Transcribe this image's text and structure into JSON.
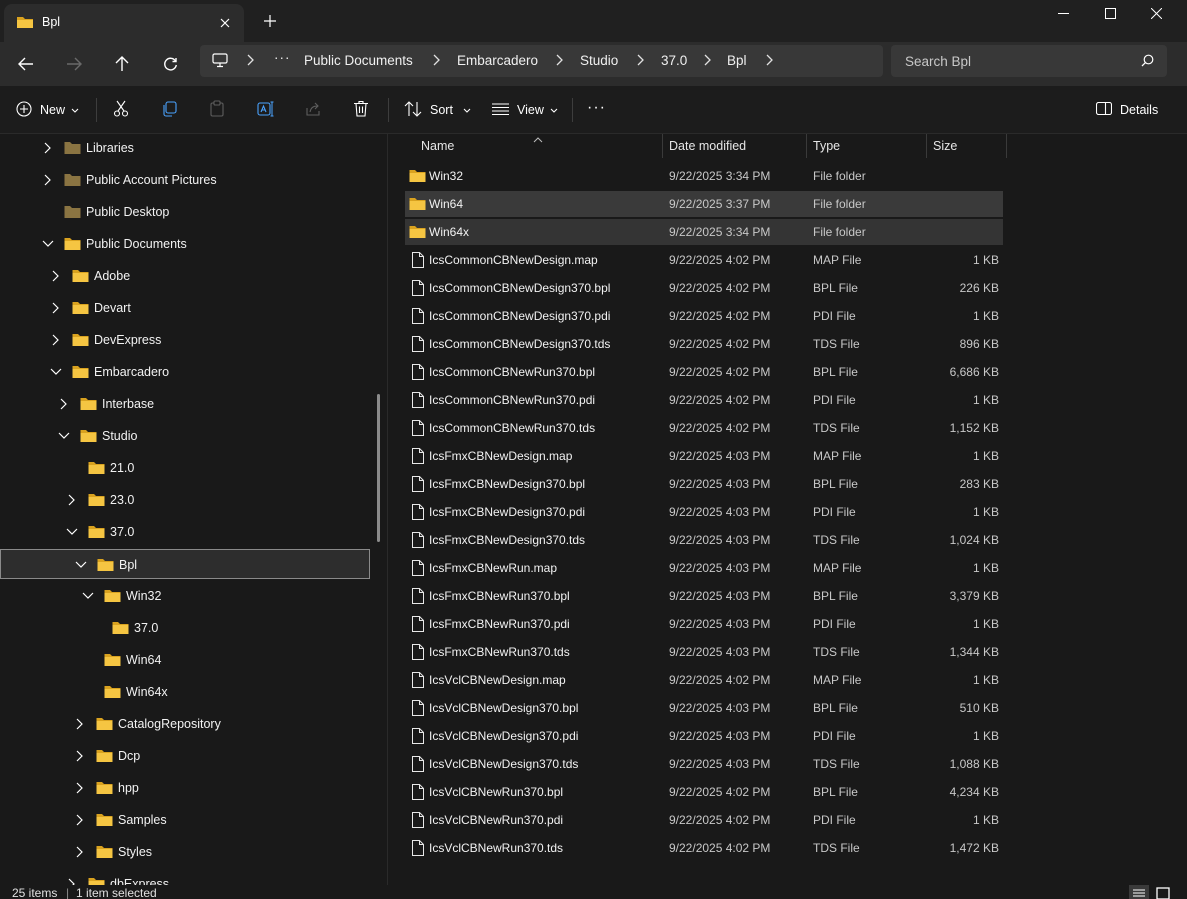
{
  "window": {
    "tab_title": "Bpl",
    "close_tab_symbol": "✕",
    "new_tab_symbol": "+",
    "minimize_symbol": "—",
    "maximize_symbol": "☐",
    "close_symbol": "✕"
  },
  "address": {
    "ellipsis": "···",
    "crumbs": [
      "Public Documents",
      "Embarcadero",
      "Studio",
      "37.0",
      "Bpl"
    ],
    "search_placeholder": "Search Bpl"
  },
  "commands": {
    "new_label": "New",
    "sort_label": "Sort",
    "view_label": "View",
    "more_label": "···",
    "details_label": "Details"
  },
  "sidebar": {
    "items": [
      {
        "label": "Libraries",
        "expanded": false,
        "has_children": true
      },
      {
        "label": "Public Account Pictures",
        "expanded": false,
        "has_children": true
      },
      {
        "label": "Public Desktop",
        "expanded": false,
        "has_children": false
      },
      {
        "label": "Public Documents",
        "expanded": true,
        "has_children": true
      },
      {
        "label": "Adobe",
        "expanded": false,
        "has_children": true
      },
      {
        "label": "Devart",
        "expanded": false,
        "has_children": true
      },
      {
        "label": "DevExpress",
        "expanded": false,
        "has_children": true
      },
      {
        "label": "Embarcadero",
        "expanded": true,
        "has_children": true
      },
      {
        "label": "Interbase",
        "expanded": false,
        "has_children": true
      },
      {
        "label": "Studio",
        "expanded": true,
        "has_children": true
      },
      {
        "label": "21.0",
        "expanded": false,
        "has_children": false
      },
      {
        "label": "23.0",
        "expanded": false,
        "has_children": true
      },
      {
        "label": "37.0",
        "expanded": true,
        "has_children": true
      },
      {
        "label": "Bpl",
        "expanded": true,
        "has_children": true,
        "selected": true
      },
      {
        "label": "Win32",
        "expanded": true,
        "has_children": true
      },
      {
        "label": "37.0",
        "expanded": false,
        "has_children": false
      },
      {
        "label": "Win64",
        "expanded": false,
        "has_children": false
      },
      {
        "label": "Win64x",
        "expanded": false,
        "has_children": false
      },
      {
        "label": "CatalogRepository",
        "expanded": false,
        "has_children": true
      },
      {
        "label": "Dcp",
        "expanded": false,
        "has_children": true
      },
      {
        "label": "hpp",
        "expanded": false,
        "has_children": true
      },
      {
        "label": "Samples",
        "expanded": false,
        "has_children": true
      },
      {
        "label": "Styles",
        "expanded": false,
        "has_children": true
      },
      {
        "label": "dbExpress",
        "expanded": false,
        "has_children": true
      }
    ]
  },
  "filelist": {
    "columns": {
      "name": "Name",
      "date": "Date modified",
      "type": "Type",
      "size": "Size"
    },
    "rows": [
      {
        "name": "Win32",
        "date": "9/22/2025 3:34 PM",
        "type": "File folder",
        "size": "",
        "kind": "folder"
      },
      {
        "name": "Win64",
        "date": "9/22/2025 3:37 PM",
        "type": "File folder",
        "size": "",
        "kind": "folder",
        "state": "selected"
      },
      {
        "name": "Win64x",
        "date": "9/22/2025 3:34 PM",
        "type": "File folder",
        "size": "",
        "kind": "folder",
        "state": "hover"
      },
      {
        "name": "IcsCommonCBNewDesign.map",
        "date": "9/22/2025 4:02 PM",
        "type": "MAP File",
        "size": "1 KB",
        "kind": "file"
      },
      {
        "name": "IcsCommonCBNewDesign370.bpl",
        "date": "9/22/2025 4:02 PM",
        "type": "BPL File",
        "size": "226 KB",
        "kind": "file"
      },
      {
        "name": "IcsCommonCBNewDesign370.pdi",
        "date": "9/22/2025 4:02 PM",
        "type": "PDI File",
        "size": "1 KB",
        "kind": "file"
      },
      {
        "name": "IcsCommonCBNewDesign370.tds",
        "date": "9/22/2025 4:02 PM",
        "type": "TDS File",
        "size": "896 KB",
        "kind": "file"
      },
      {
        "name": "IcsCommonCBNewRun370.bpl",
        "date": "9/22/2025 4:02 PM",
        "type": "BPL File",
        "size": "6,686 KB",
        "kind": "file"
      },
      {
        "name": "IcsCommonCBNewRun370.pdi",
        "date": "9/22/2025 4:02 PM",
        "type": "PDI File",
        "size": "1 KB",
        "kind": "file"
      },
      {
        "name": "IcsCommonCBNewRun370.tds",
        "date": "9/22/2025 4:02 PM",
        "type": "TDS File",
        "size": "1,152 KB",
        "kind": "file"
      },
      {
        "name": "IcsFmxCBNewDesign.map",
        "date": "9/22/2025 4:03 PM",
        "type": "MAP File",
        "size": "1 KB",
        "kind": "file"
      },
      {
        "name": "IcsFmxCBNewDesign370.bpl",
        "date": "9/22/2025 4:03 PM",
        "type": "BPL File",
        "size": "283 KB",
        "kind": "file"
      },
      {
        "name": "IcsFmxCBNewDesign370.pdi",
        "date": "9/22/2025 4:03 PM",
        "type": "PDI File",
        "size": "1 KB",
        "kind": "file"
      },
      {
        "name": "IcsFmxCBNewDesign370.tds",
        "date": "9/22/2025 4:03 PM",
        "type": "TDS File",
        "size": "1,024 KB",
        "kind": "file"
      },
      {
        "name": "IcsFmxCBNewRun.map",
        "date": "9/22/2025 4:03 PM",
        "type": "MAP File",
        "size": "1 KB",
        "kind": "file"
      },
      {
        "name": "IcsFmxCBNewRun370.bpl",
        "date": "9/22/2025 4:03 PM",
        "type": "BPL File",
        "size": "3,379 KB",
        "kind": "file"
      },
      {
        "name": "IcsFmxCBNewRun370.pdi",
        "date": "9/22/2025 4:03 PM",
        "type": "PDI File",
        "size": "1 KB",
        "kind": "file"
      },
      {
        "name": "IcsFmxCBNewRun370.tds",
        "date": "9/22/2025 4:03 PM",
        "type": "TDS File",
        "size": "1,344 KB",
        "kind": "file"
      },
      {
        "name": "IcsVclCBNewDesign.map",
        "date": "9/22/2025 4:02 PM",
        "type": "MAP File",
        "size": "1 KB",
        "kind": "file"
      },
      {
        "name": "IcsVclCBNewDesign370.bpl",
        "date": "9/22/2025 4:03 PM",
        "type": "BPL File",
        "size": "510 KB",
        "kind": "file"
      },
      {
        "name": "IcsVclCBNewDesign370.pdi",
        "date": "9/22/2025 4:03 PM",
        "type": "PDI File",
        "size": "1 KB",
        "kind": "file"
      },
      {
        "name": "IcsVclCBNewDesign370.tds",
        "date": "9/22/2025 4:03 PM",
        "type": "TDS File",
        "size": "1,088 KB",
        "kind": "file"
      },
      {
        "name": "IcsVclCBNewRun370.bpl",
        "date": "9/22/2025 4:02 PM",
        "type": "BPL File",
        "size": "4,234 KB",
        "kind": "file"
      },
      {
        "name": "IcsVclCBNewRun370.pdi",
        "date": "9/22/2025 4:02 PM",
        "type": "PDI File",
        "size": "1 KB",
        "kind": "file"
      },
      {
        "name": "IcsVclCBNewRun370.tds",
        "date": "9/22/2025 4:02 PM",
        "type": "TDS File",
        "size": "1,472 KB",
        "kind": "file"
      }
    ]
  },
  "status": {
    "item_count": "25 items",
    "divider": "|",
    "selection": "1 item selected"
  },
  "colors": {
    "folder": "#f5c542",
    "folder_dark": "#d9a21f",
    "folder_muted": "#8a7442",
    "background": "#191919",
    "selected_row": "#3a3a3a"
  }
}
